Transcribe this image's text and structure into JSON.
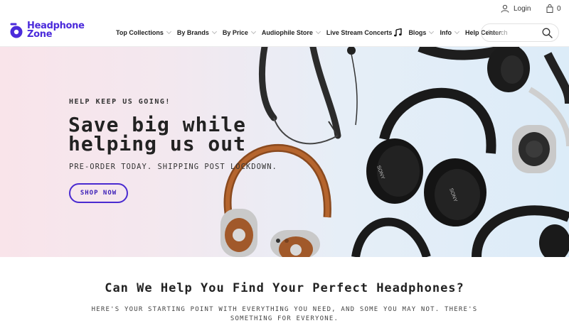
{
  "header": {
    "login_label": "Login",
    "cart_count": "0"
  },
  "brand": {
    "logo_line1": "Headphone",
    "logo_line2": "Zone",
    "accent_color": "#4b2bdb"
  },
  "nav": {
    "items": [
      {
        "label": "Top Collections",
        "has_dropdown": true
      },
      {
        "label": "By Brands",
        "has_dropdown": true
      },
      {
        "label": "By Price",
        "has_dropdown": true
      },
      {
        "label": "Audiophile Store",
        "has_dropdown": true
      },
      {
        "label": "Live Stream Concerts",
        "icon": "music-note-icon",
        "has_dropdown": false
      },
      {
        "label": "Blogs",
        "has_dropdown": true
      },
      {
        "label": "Info",
        "has_dropdown": true
      },
      {
        "label": "Help Center",
        "has_dropdown": false
      }
    ]
  },
  "search": {
    "placeholder": "Search"
  },
  "hero": {
    "kicker": "HELP KEEP US GOING!",
    "headline_line1": "Save big while",
    "headline_line2": "helping us out",
    "subline": "PRE-ORDER TODAY. SHIPPING POST LOCKDOWN.",
    "cta_label": "SHOP NOW",
    "slide_count": 2,
    "active_slide": 1,
    "product_text": {
      "brand_a": "SONY",
      "brand_b": "SONY"
    }
  },
  "finder": {
    "title": "Can We Help You Find Your Perfect Headphones?",
    "subtitle": "HERE'S YOUR STARTING POINT WITH EVERYTHING YOU NEED, AND SOME YOU MAY NOT. THERE'S SOMETHING FOR EVERYONE."
  }
}
